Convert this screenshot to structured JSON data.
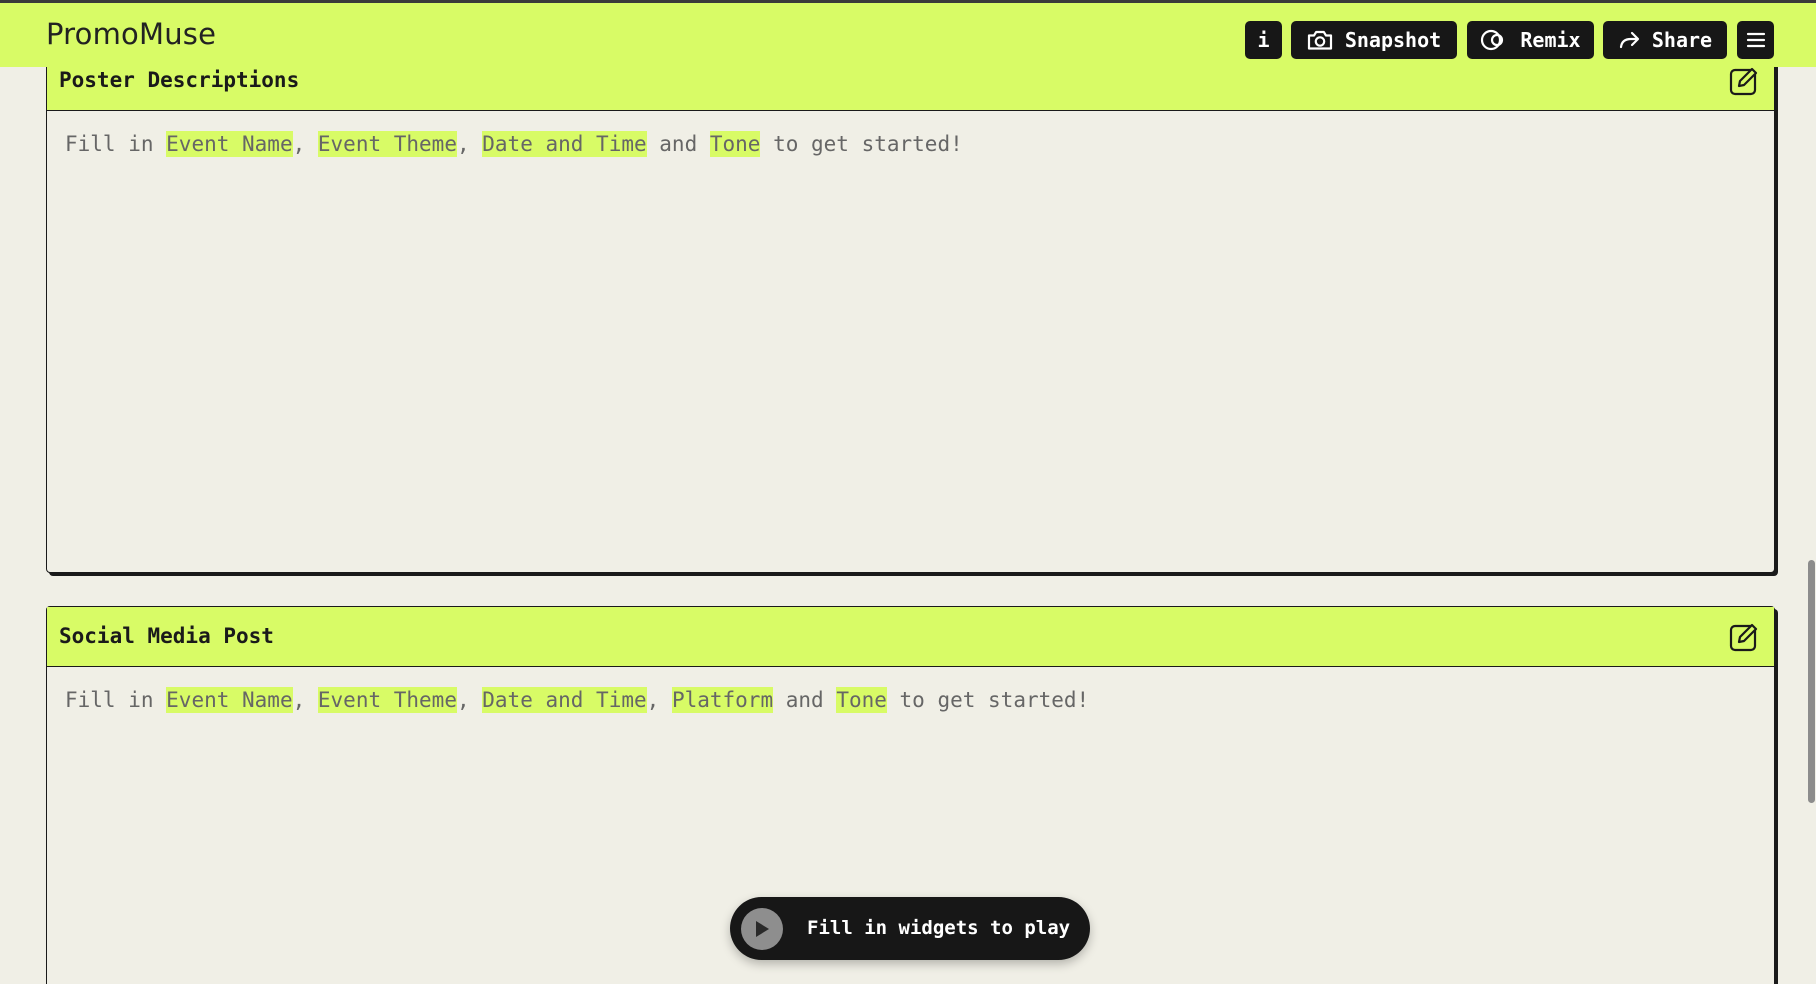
{
  "app": {
    "title": "PromoMuse"
  },
  "header": {
    "info_label": "i",
    "snapshot_label": "Snapshot",
    "remix_label": "Remix",
    "share_label": "Share"
  },
  "cards": [
    {
      "title": "Poster Descriptions",
      "body": [
        {
          "text": "Fill in ",
          "hl": false
        },
        {
          "text": "Event Name",
          "hl": true
        },
        {
          "text": ", ",
          "hl": false
        },
        {
          "text": "Event Theme",
          "hl": true
        },
        {
          "text": ", ",
          "hl": false
        },
        {
          "text": "Date and Time",
          "hl": true
        },
        {
          "text": " and ",
          "hl": false
        },
        {
          "text": "Tone",
          "hl": true
        },
        {
          "text": " to get started!",
          "hl": false
        }
      ]
    },
    {
      "title": "Social Media Post",
      "body": [
        {
          "text": "Fill in ",
          "hl": false
        },
        {
          "text": "Event Name",
          "hl": true
        },
        {
          "text": ", ",
          "hl": false
        },
        {
          "text": "Event Theme",
          "hl": true
        },
        {
          "text": ", ",
          "hl": false
        },
        {
          "text": "Date and Time",
          "hl": true
        },
        {
          "text": ", ",
          "hl": false
        },
        {
          "text": "Platform",
          "hl": true
        },
        {
          "text": " and ",
          "hl": false
        },
        {
          "text": "Tone",
          "hl": true
        },
        {
          "text": " to get started!",
          "hl": false
        }
      ]
    }
  ],
  "play": {
    "label": "Fill in widgets to play"
  },
  "colors": {
    "accent": "#d8fb66",
    "dark": "#171717",
    "background": "#f0efe6"
  },
  "icons": [
    "camera-icon",
    "remix-icon",
    "share-arrow-icon",
    "hamburger-menu-icon",
    "edit-icon",
    "play-icon"
  ]
}
